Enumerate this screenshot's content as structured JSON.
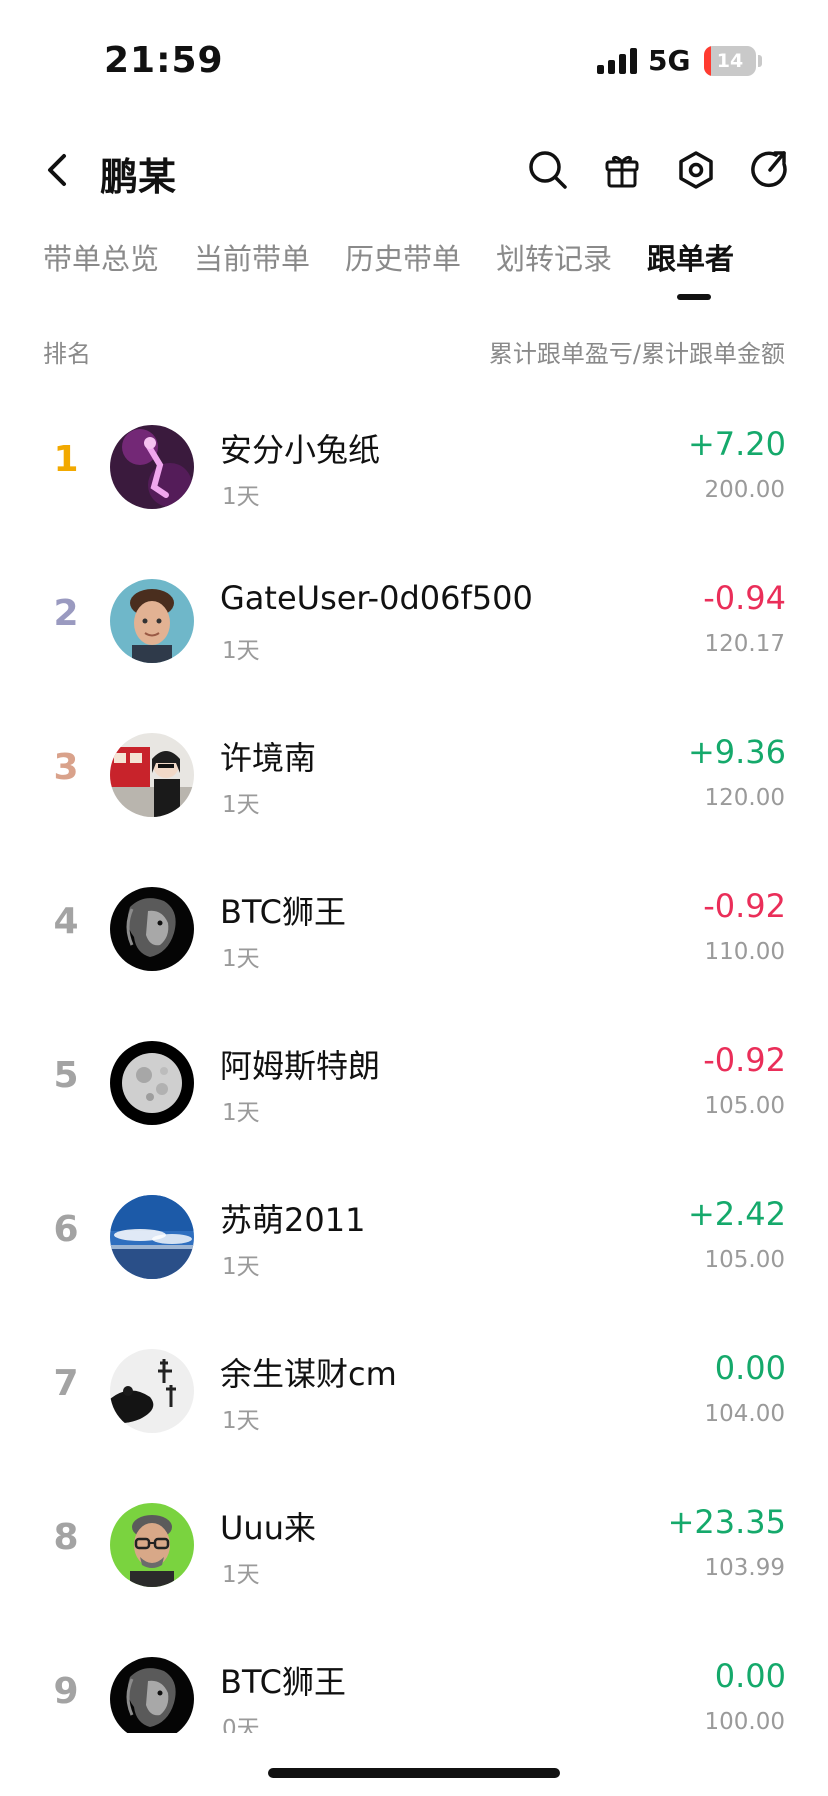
{
  "status_bar": {
    "time": "21:59",
    "network": "5G",
    "battery": "14",
    "battery_level": 0.14,
    "battery_color": "#ff3b30"
  },
  "nav": {
    "title": "鹏某",
    "icons": [
      "back-icon",
      "search-icon",
      "gift-icon",
      "settings-icon",
      "share-icon"
    ]
  },
  "tabs": [
    {
      "label": "带单总览",
      "active": false
    },
    {
      "label": "当前带单",
      "active": false
    },
    {
      "label": "历史带单",
      "active": false
    },
    {
      "label": "划转记录",
      "active": false
    },
    {
      "label": "跟单者",
      "active": true
    }
  ],
  "list_header": {
    "rank_label": "排名",
    "pnl_label": "累计跟单盈亏/累计跟单金额"
  },
  "colors": {
    "positive": "#15a96b",
    "negative": "#ea2e59",
    "rank_gold": "#f2a900",
    "rank_silver": "#9a9ac0",
    "rank_bronze": "#d9a28b"
  },
  "followers": [
    {
      "rank": "1",
      "name": "安分小兔纸",
      "days": "1天",
      "pnl": "+7.20",
      "amount": "200.00",
      "trend": "pos",
      "avatar": "purple-figure-avatar"
    },
    {
      "rank": "2",
      "name": "GateUser-0d06f500",
      "days": "1天",
      "pnl": "-0.94",
      "amount": "120.17",
      "trend": "neg",
      "avatar": "young-man-avatar"
    },
    {
      "rank": "3",
      "name": "许境南",
      "days": "1天",
      "pnl": "+9.36",
      "amount": "120.00",
      "trend": "pos",
      "avatar": "anime-street-avatar"
    },
    {
      "rank": "4",
      "name": "BTC狮王",
      "days": "1天",
      "pnl": "-0.92",
      "amount": "110.00",
      "trend": "neg",
      "avatar": "lion-avatar"
    },
    {
      "rank": "5",
      "name": "阿姆斯特朗",
      "days": "1天",
      "pnl": "-0.92",
      "amount": "105.00",
      "trend": "neg",
      "avatar": "moon-avatar"
    },
    {
      "rank": "6",
      "name": "苏萌2011",
      "days": "1天",
      "pnl": "+2.42",
      "amount": "105.00",
      "trend": "pos",
      "avatar": "sky-sea-avatar"
    },
    {
      "rank": "7",
      "name": "余生谋财cm",
      "days": "1天",
      "pnl": "0.00",
      "amount": "104.00",
      "trend": "pos",
      "avatar": "ink-calligraphy-avatar"
    },
    {
      "rank": "8",
      "name": "Uuu来",
      "days": "1天",
      "pnl": "+23.35",
      "amount": "103.99",
      "trend": "pos",
      "avatar": "glasses-man-avatar"
    },
    {
      "rank": "9",
      "name": "BTC狮王",
      "days": "0天",
      "pnl": "0.00",
      "amount": "100.00",
      "trend": "pos",
      "avatar": "lion-avatar"
    }
  ]
}
